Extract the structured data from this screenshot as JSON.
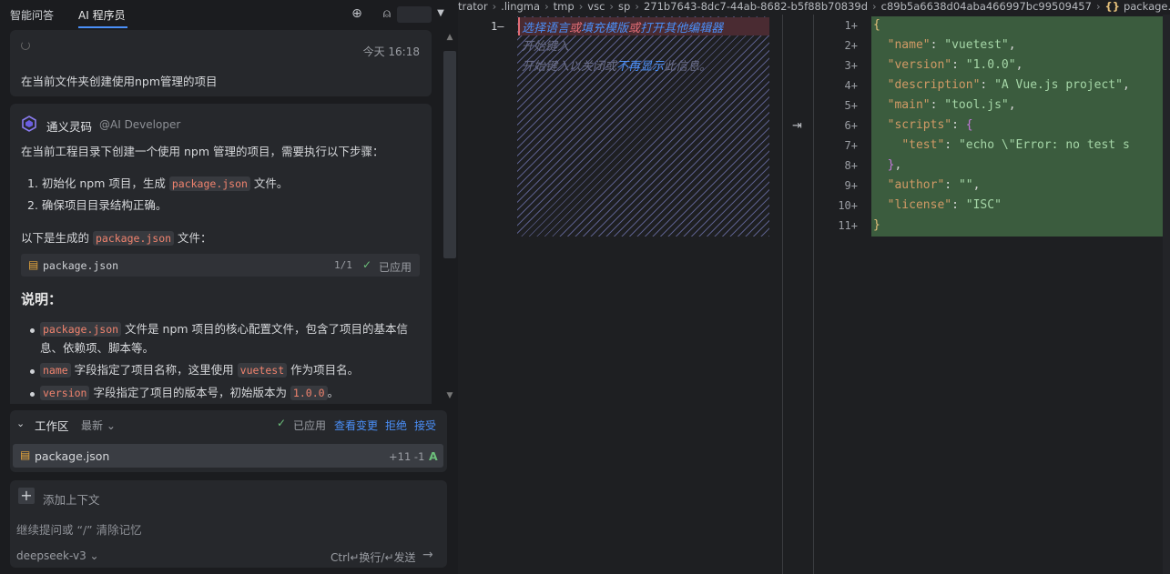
{
  "left_panel": {
    "tabs": [
      {
        "label": "智能问答",
        "active": false
      },
      {
        "label": "AI 程序员",
        "active": true
      }
    ],
    "icons": {
      "new_chat": "plus-circle-icon",
      "user": "user-icon",
      "menu": "caret-down-icon"
    },
    "user_message": {
      "time": "今天 16:18",
      "text": "在当前文件夹创建使用npm管理的项目"
    },
    "reply": {
      "bot_name": "通义灵码",
      "bot_handle": "@AI Developer",
      "intro": "在当前工程目录下创建一个使用 npm 管理的项目，需要执行以下步骤：",
      "steps": [
        {
          "pre": "1. 初始化 npm 项目，生成 ",
          "code": "package.json",
          "post": " 文件。"
        },
        {
          "pre": "2. 确保项目目录结构正确。",
          "code": "",
          "post": ""
        }
      ],
      "generated_pre": "以下是生成的 ",
      "generated_code": "package.json",
      "generated_post": " 文件：",
      "file_chip": {
        "name": "package.json",
        "count": "1/1",
        "status": "已应用"
      },
      "section_title": "说明：",
      "notes": [
        {
          "code": "package.json",
          "text": " 文件是 npm 项目的核心配置文件，包含了项目的基本信",
          "text2": "息、依赖项、脚本等。"
        },
        {
          "code": "name",
          "text": " 字段指定了项目名称，这里使用 ",
          "code2": "vuetest",
          "text3": " 作为项目名。"
        },
        {
          "code": "version",
          "text": " 字段指定了项目的版本号，初始版本为 ",
          "code2": "1.0.0",
          "text3": "。"
        }
      ]
    },
    "workspace": {
      "title": "工作区",
      "filter": "最新",
      "status": "已应用",
      "links": [
        "查看变更",
        "拒绝",
        "接受"
      ],
      "file": {
        "name": "package.json",
        "diff": "+11 -1",
        "status": "A"
      }
    },
    "input": {
      "add_context": "添加上下文",
      "placeholder": "继续提问或 “/” 清除记忆",
      "model": "deepseek-v3",
      "send_hint": "Ctrl↵换行/↵发送"
    }
  },
  "editor": {
    "breadcrumb": [
      "trator",
      ".lingma",
      "tmp",
      "vsc",
      "sp",
      "271b7643-8dc7-44ab-8682-b5f88b70839d",
      "c89b5a6638d04aba466997bc99509457",
      "package."
    ],
    "breadcrumb_json_icon": "{}",
    "left_pane": {
      "line_number": "1—",
      "hints": [
        {
          "parts": [
            {
              "t": "选择语言",
              "c": "#4a8ff8"
            },
            {
              "t": "或",
              "c": "#e06c75"
            },
            {
              "t": "填充模版",
              "c": "#4a8ff8"
            },
            {
              "t": "或",
              "c": "#e06c75"
            },
            {
              "t": "打开其他编辑器",
              "c": "#4a8ff8"
            }
          ]
        },
        {
          "parts": [
            {
              "t": "开始键入",
              "c": "#6b6f8a"
            }
          ]
        },
        {
          "parts": [
            {
              "t": "开始键入以关闭或",
              "c": "#6b6f8a"
            },
            {
              "t": "不再显示",
              "c": "#4a8ff8"
            },
            {
              "t": "此信息。",
              "c": "#6b6f8a"
            }
          ]
        }
      ]
    },
    "right_pane": {
      "line_numbers": [
        "1+",
        "2+",
        "3+",
        "4+",
        "5+",
        "6+",
        "7+",
        "8+",
        "9+",
        "10+",
        "11+"
      ],
      "lines": [
        [
          {
            "t": "{",
            "c": "b"
          }
        ],
        [
          {
            "t": "  ",
            "c": ""
          },
          {
            "t": "\"name\"",
            "c": "k"
          },
          {
            "t": ": ",
            "c": ""
          },
          {
            "t": "\"vuetest\"",
            "c": "s"
          },
          {
            "t": ",",
            "c": ""
          }
        ],
        [
          {
            "t": "  ",
            "c": ""
          },
          {
            "t": "\"version\"",
            "c": "k"
          },
          {
            "t": ": ",
            "c": ""
          },
          {
            "t": "\"1.0.0\"",
            "c": "s"
          },
          {
            "t": ",",
            "c": ""
          }
        ],
        [
          {
            "t": "  ",
            "c": ""
          },
          {
            "t": "\"description\"",
            "c": "k"
          },
          {
            "t": ": ",
            "c": ""
          },
          {
            "t": "\"A Vue.js project\"",
            "c": "s"
          },
          {
            "t": ",",
            "c": ""
          }
        ],
        [
          {
            "t": "  ",
            "c": ""
          },
          {
            "t": "\"main\"",
            "c": "k"
          },
          {
            "t": ": ",
            "c": ""
          },
          {
            "t": "\"tool.js\"",
            "c": "s"
          },
          {
            "t": ",",
            "c": ""
          }
        ],
        [
          {
            "t": "  ",
            "c": ""
          },
          {
            "t": "\"scripts\"",
            "c": "k"
          },
          {
            "t": ": ",
            "c": ""
          },
          {
            "t": "{",
            "c": "v"
          }
        ],
        [
          {
            "t": "    ",
            "c": ""
          },
          {
            "t": "\"test\"",
            "c": "k"
          },
          {
            "t": ": ",
            "c": ""
          },
          {
            "t": "\"echo \\\"Error: no test s",
            "c": "s"
          }
        ],
        [
          {
            "t": "  ",
            "c": ""
          },
          {
            "t": "}",
            "c": "v"
          },
          {
            "t": ",",
            "c": ""
          }
        ],
        [
          {
            "t": "  ",
            "c": ""
          },
          {
            "t": "\"author\"",
            "c": "k"
          },
          {
            "t": ": ",
            "c": ""
          },
          {
            "t": "\"\"",
            "c": "s"
          },
          {
            "t": ",",
            "c": ""
          }
        ],
        [
          {
            "t": "  ",
            "c": ""
          },
          {
            "t": "\"license\"",
            "c": "k"
          },
          {
            "t": ": ",
            "c": ""
          },
          {
            "t": "\"ISC\"",
            "c": "s"
          }
        ],
        [
          {
            "t": "}",
            "c": "b"
          }
        ]
      ]
    }
  },
  "colors": {
    "accent": "#4a8ff8",
    "diff_added": "#3b5c3e",
    "success": "#6cbf7a",
    "code_inline": "#f0836e"
  }
}
